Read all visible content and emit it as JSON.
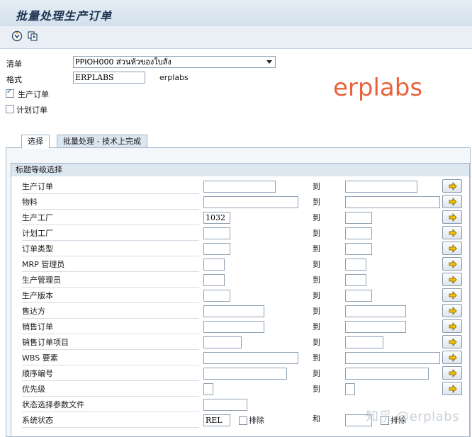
{
  "title": "批量处理生产订单",
  "toolbar": {
    "icons": [
      "execute-icon",
      "copy-icon"
    ]
  },
  "header": {
    "list_label": "清单",
    "list_value": "PPIOH000 ส่วนหัวของใบสั่ง",
    "format_label": "格式",
    "format_value": "ERPLABS",
    "format_desc": "erplabs",
    "production_order_label": "生产订单",
    "production_order_checked": true,
    "planned_order_label": "计划订单",
    "planned_order_checked": false
  },
  "brand_text": "erplabs",
  "tabs": [
    {
      "label": "选择",
      "active": true
    },
    {
      "label": "批量处理 - 技术上完成",
      "active": false
    }
  ],
  "group_title": "标题等级选择",
  "to_label": "到",
  "and_label": "和",
  "exclude_label": "排除",
  "rows": [
    {
      "label": "生产订单",
      "from": "",
      "to": ""
    },
    {
      "label": "物料",
      "from": "",
      "to": ""
    },
    {
      "label": "生产工厂",
      "from": "1032",
      "to": ""
    },
    {
      "label": "计划工厂",
      "from": "",
      "to": ""
    },
    {
      "label": "订单类型",
      "from": "",
      "to": ""
    },
    {
      "label": "MRP 管理员",
      "from": "",
      "to": ""
    },
    {
      "label": "生产管理员",
      "from": "",
      "to": ""
    },
    {
      "label": "生产版本",
      "from": "",
      "to": ""
    },
    {
      "label": "售达方",
      "from": "",
      "to": ""
    },
    {
      "label": "销售订单",
      "from": "",
      "to": ""
    },
    {
      "label": "销售订单项目",
      "from": "",
      "to": ""
    },
    {
      "label": "WBS 要素",
      "from": "",
      "to": ""
    },
    {
      "label": "顺序编号",
      "from": "",
      "to": ""
    },
    {
      "label": "优先级",
      "from": "",
      "to": ""
    },
    {
      "label": "状态选择参数文件",
      "from": ""
    },
    {
      "label": "系统状态",
      "from": "REL",
      "to": "",
      "exclude_from": false,
      "exclude_to": false
    }
  ],
  "watermark": "知乎 @erplabs",
  "colors": {
    "brand": "#e8633b",
    "title": "#1f3552",
    "arrow_button_icon": "#f2c200"
  }
}
